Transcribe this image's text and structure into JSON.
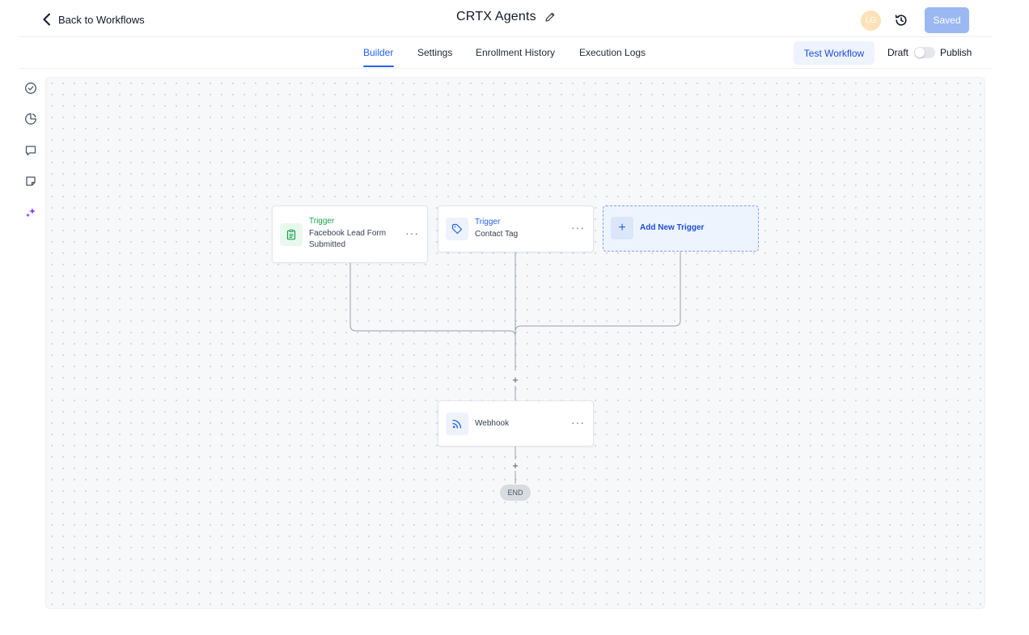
{
  "header": {
    "back_label": "Back to Workflows",
    "title": "CRTX Agents",
    "avatar_initials": "LG",
    "saved_label": "Saved"
  },
  "tabs": [
    {
      "label": "Builder",
      "active": true
    },
    {
      "label": "Settings",
      "active": false
    },
    {
      "label": "Enrollment History",
      "active": false
    },
    {
      "label": "Execution Logs",
      "active": false
    }
  ],
  "actions": {
    "test_label": "Test Workflow",
    "draft_label": "Draft",
    "publish_label": "Publish",
    "publish_on": false
  },
  "sidebar": {
    "icons": [
      "check-circle-icon",
      "pie-chart-icon",
      "chat-bubble-icon",
      "sticky-note-icon",
      "sparkle-icon"
    ]
  },
  "workflow": {
    "triggers": [
      {
        "kicker": "Trigger",
        "label_line1": "Facebook Lead Form",
        "label_line2": "Submitted",
        "icon": "clipboard-icon",
        "accent": "#16a34a"
      },
      {
        "kicker": "Trigger",
        "label_line1": "Contact Tag",
        "icon": "tag-icon",
        "accent": "#2563eb"
      }
    ],
    "add_trigger_label": "Add New Trigger",
    "action": {
      "label": "Webhook",
      "icon": "rss-icon"
    },
    "end_label": "END",
    "plus_symbol": "+",
    "more_symbol": "···"
  },
  "colors": {
    "accent": "#2563eb",
    "trigger_green": "#16a34a",
    "saved_button": "#9bb8f2"
  }
}
